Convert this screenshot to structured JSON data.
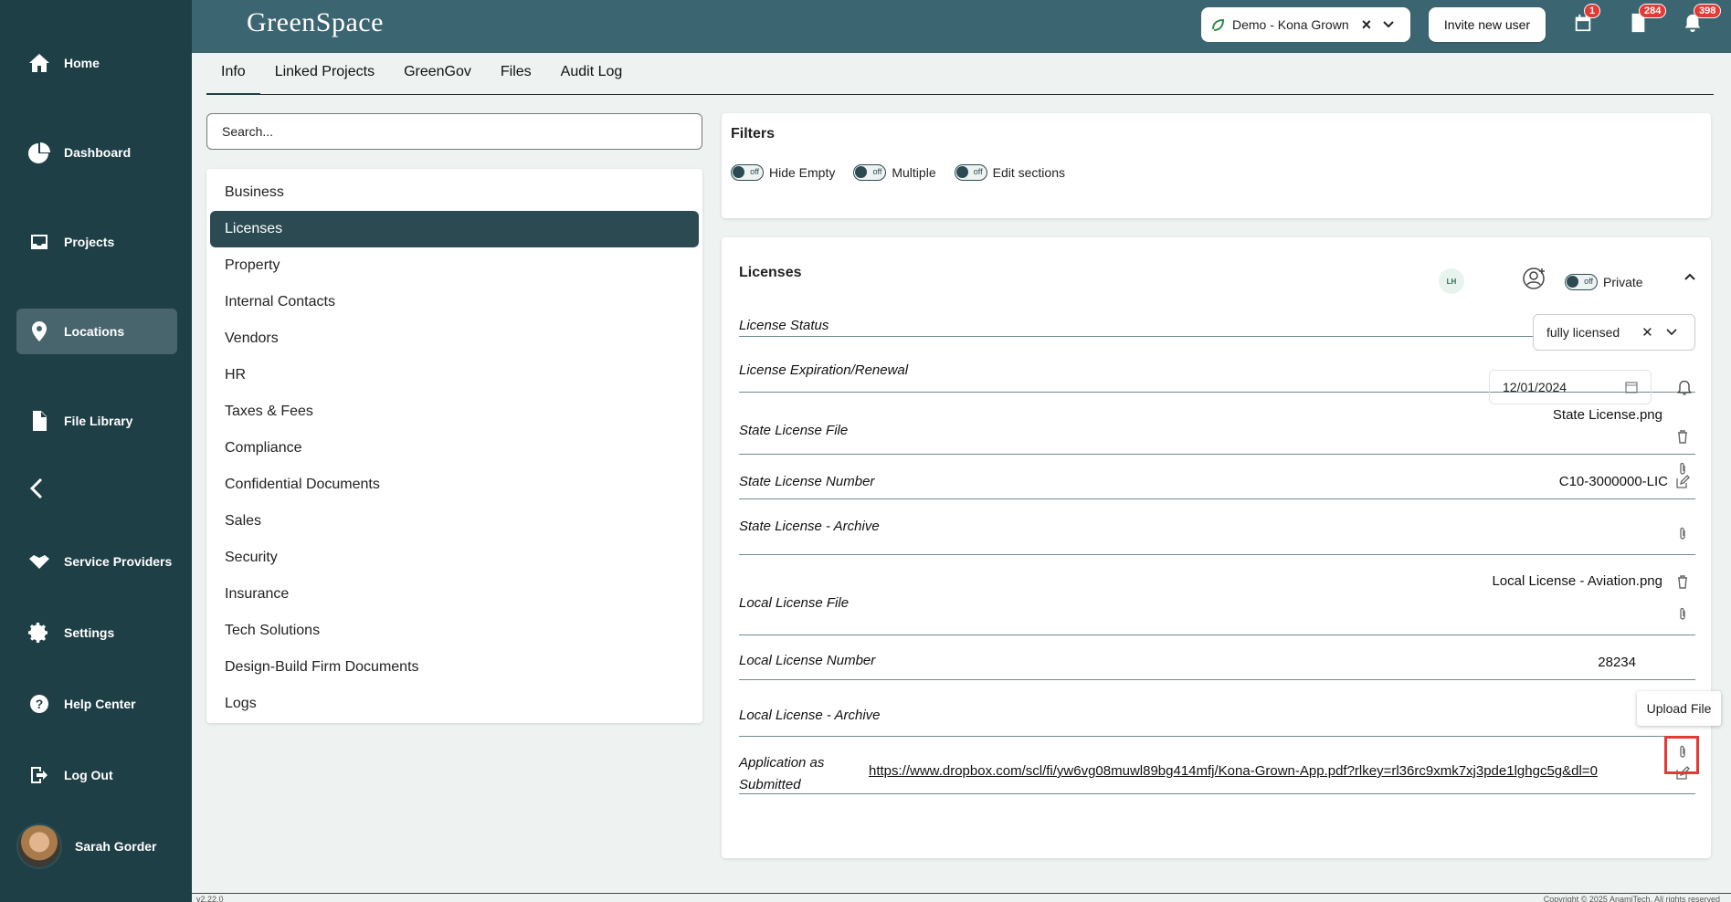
{
  "app": {
    "name": "GreenSpace"
  },
  "sidebar": {
    "items": [
      {
        "label": "Home",
        "icon": "home-icon"
      },
      {
        "label": "Dashboard",
        "icon": "pie-chart-icon"
      },
      {
        "label": "Projects",
        "icon": "inbox-icon"
      },
      {
        "label": "Locations",
        "icon": "map-pin-icon",
        "active": true
      },
      {
        "label": "File Library",
        "icon": "file-icon"
      },
      {
        "label": "Service Providers",
        "icon": "handshake-icon"
      },
      {
        "label": "Settings",
        "icon": "gear-icon"
      },
      {
        "label": "Help Center",
        "icon": "help-icon"
      },
      {
        "label": "Log Out",
        "icon": "logout-icon"
      }
    ],
    "user_name": "Sarah Gorder"
  },
  "topbar": {
    "tenant": "Demo - Kona Grown",
    "invite_label": "Invite new user",
    "badges": {
      "calendar": "1",
      "documents": "284",
      "notifications": "398"
    }
  },
  "tabs": [
    "Info",
    "Linked Projects",
    "GreenGov",
    "Files",
    "Audit Log"
  ],
  "search": {
    "placeholder": "Search..."
  },
  "categories": [
    "Business",
    "Licenses",
    "Property",
    "Internal Contacts",
    "Vendors",
    "HR",
    "Taxes & Fees",
    "Compliance",
    "Confidential Documents",
    "Sales",
    "Security",
    "Insurance",
    "Tech Solutions",
    "Design-Build Firm Documents",
    "Logs"
  ],
  "filters": {
    "title": "Filters",
    "toggles": [
      {
        "state": "off",
        "label": "Hide Empty"
      },
      {
        "state": "off",
        "label": "Multiple"
      },
      {
        "state": "off",
        "label": "Edit sections"
      }
    ]
  },
  "licenses": {
    "title": "Licenses",
    "initials": "LH",
    "privacy_toggle_state": "off",
    "privacy_label": "Private",
    "status_label": "License Status",
    "status_value": "fully licensed",
    "expiration_label": "License Expiration/Renewal",
    "expiration_value": "12/01/2024",
    "state_file_label": "State License File",
    "state_file_value": "State License.png",
    "state_number_label": "State License Number",
    "state_number_value": "C10-3000000-LIC",
    "state_archive_label": "State License - Archive",
    "local_file_label": "Local License File",
    "local_file_value": "Local License - Aviation.png",
    "local_number_label": "Local License Number",
    "local_number_value": "28234",
    "local_archive_label": "Local License - Archive",
    "application_label_line1": "Application as",
    "application_label_line2": "Submitted",
    "application_link": "https://www.dropbox.com/scl/fi/yw6vg08muwl89bg414mfj/Kona-Grown-App.pdf?rlkey=rl36rc9xmk7xj3pde1lghgc5g&dl=0"
  },
  "tooltip": "Upload File",
  "footer": {
    "version": "v2.22.0",
    "copyright": "Copyright © 2025 AnamiTech. All rights reserved"
  }
}
